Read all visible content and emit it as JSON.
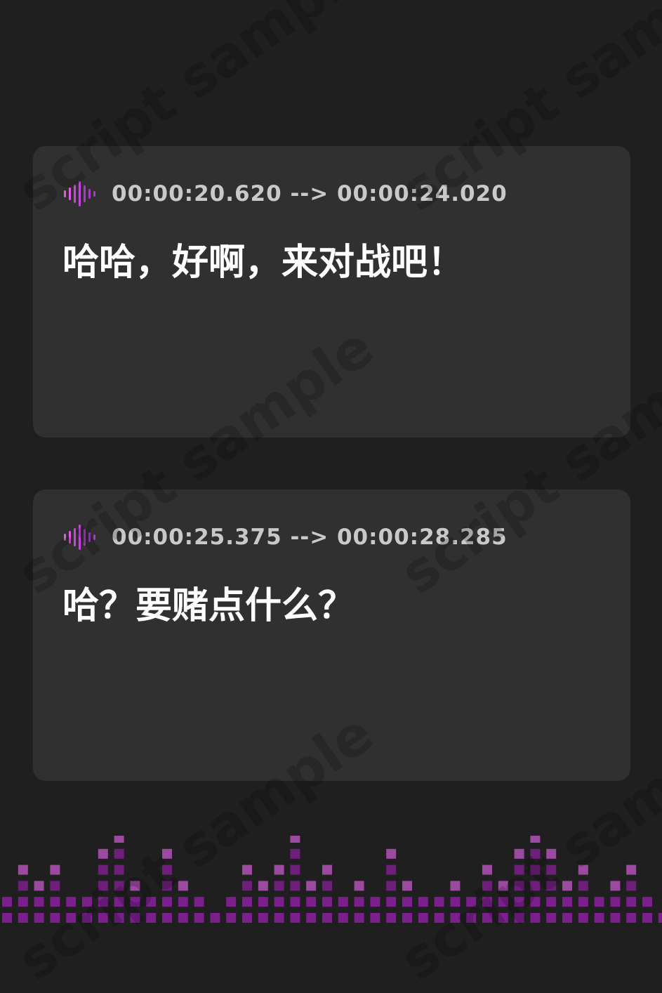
{
  "subtitles": [
    {
      "timestamp": "00:00:20.620 --> 00:00:24.020",
      "text": "哈哈，好啊，来对战吧！"
    },
    {
      "timestamp": "00:00:25.375 --> 00:00:28.285",
      "text": "哈？要赌点什么？"
    }
  ],
  "watermark": {
    "text": "script sample"
  },
  "icons": {
    "timestamp_icon": "sound-wave-icon"
  },
  "colors": {
    "background": "#1f1f20",
    "card": "#303031",
    "timestamp_text": "#c9c9c9",
    "subtitle_text": "#ffffff",
    "accent_light": "#e05ae6",
    "accent_dark": "#7a1f8c"
  },
  "equalizer_levels": [
    2,
    4,
    3,
    4,
    2,
    2,
    5,
    6,
    3,
    2,
    5,
    3,
    2,
    1,
    2,
    4,
    3,
    4,
    6,
    3,
    4,
    2,
    3,
    2,
    5,
    3,
    2,
    2,
    3,
    2,
    4,
    3,
    5,
    6,
    5,
    3,
    4,
    2,
    3,
    4,
    2,
    1
  ]
}
